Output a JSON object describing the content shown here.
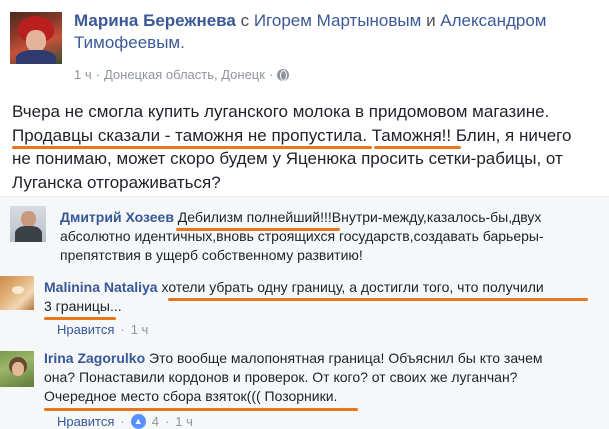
{
  "post": {
    "author": "Марина Бережнева",
    "with_word": "с",
    "tagged_1": "Игорем Мартыновым",
    "and_word": "и",
    "tagged_2_line1": "Александром",
    "tagged_2_line2": "Тимофеевым.",
    "time": "1 ч",
    "dot": "·",
    "location": "Донецкая область, Донецк",
    "dot2": "·",
    "privacy_icon": "globe-icon",
    "body_lines": [
      "Вчера не смогла купить луганского молока в придомовом магазине.",
      "Продавцы сказали - таможня не пропустила. Таможня!! Блин, я ничего",
      "не понимаю, может скоро будем у Яценюка просить сетки-рабицы, от",
      "Луганска отгораживаться?"
    ]
  },
  "comments": [
    {
      "author": "Дмитрий Хозеев",
      "lines": [
        " Дебилизм полнейший!!!Внутри-между,казалось-бы,двух",
        "абсолютно идентичных,вновь строящихся государств,создавать барьеры-",
        "препятствия в ущерб собственному развитию!"
      ]
    },
    {
      "author": "Malinina Nataliya",
      "lines": [
        " хотели убрать одну границу, а достигли того, что получили",
        "3 границы..."
      ],
      "like_label": "Нравится",
      "dot": "·",
      "time": "1 ч"
    },
    {
      "author": "Irina Zagorulko",
      "lines": [
        " Это вообще малопонятная граница! Объяснил бы кто зачем",
        "она? Понаставили кордонов и проверок. От кого? от своих же луганчан?",
        "Очередное место сбора взяток((( Позорники."
      ],
      "like_label": "Нравится",
      "dot": "·",
      "like_count": "4",
      "dot2": "·",
      "time": "1 ч"
    }
  ],
  "colors": {
    "link": "#3b5998",
    "highlight": "#e8761c",
    "meta": "#90949c"
  }
}
